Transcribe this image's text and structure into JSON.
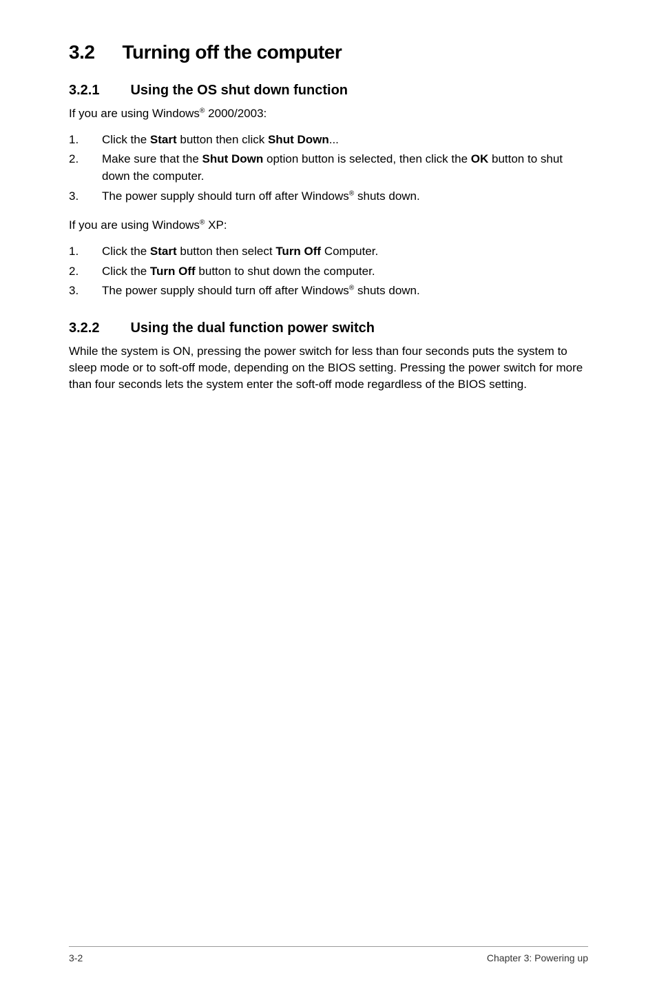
{
  "heading": {
    "number": "3.2",
    "title": "Turning off the computer"
  },
  "section1": {
    "number": "3.2.1",
    "title": "Using the OS shut down function",
    "intro_prefix": "If you are using Windows",
    "intro_suffix": " 2000/2003:",
    "step1_a": "Click the ",
    "step1_b": "Start",
    "step1_c": " button then click ",
    "step1_d": "Shut Down",
    "step1_e": "...",
    "step2_a": "Make sure that the ",
    "step2_b": "Shut Down",
    "step2_c": " option button is selected, then click the ",
    "step2_d": "OK",
    "step2_e": " button to shut down the computer.",
    "step3_a": "The power supply should turn off after Windows",
    "step3_b": " shuts down.",
    "intro2_prefix": "If you are using Windows",
    "intro2_suffix": " XP:",
    "xpstep1_a": "Click the ",
    "xpstep1_b": "Start",
    "xpstep1_c": " button then select ",
    "xpstep1_d": "Turn Off",
    "xpstep1_e": " Computer.",
    "xpstep2_a": "Click the ",
    "xpstep2_b": "Turn Off",
    "xpstep2_c": " button to shut down the computer.",
    "xpstep3_a": "The power supply should turn off after Windows",
    "xpstep3_b": " shuts down."
  },
  "section2": {
    "number": "3.2.2",
    "title": "Using the dual function power switch",
    "body": "While the system is ON, pressing the power switch for less than four seconds puts the system to sleep mode or to soft-off mode, depending on the BIOS setting. Pressing the power switch for more than four seconds lets the system enter the soft-off mode regardless of the BIOS setting."
  },
  "footer": {
    "left": "3-2",
    "right": "Chapter 3: Powering up"
  },
  "reg": "®"
}
